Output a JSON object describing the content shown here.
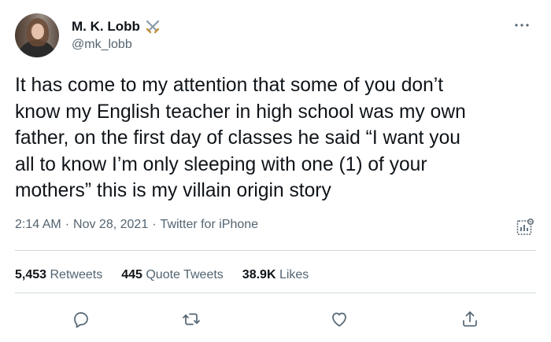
{
  "author": {
    "name": "M. K. Lobb",
    "handle": "@mk_lobb",
    "name_emoji_icon": "crossed-swords-icon"
  },
  "tweet": {
    "lines": [
      "It has come to my attention that some of you don’t",
      "know my English teacher in high school was my own",
      "father, on the first day of classes he said “I want you",
      "all to know I’m only sleeping with one (1) of your",
      "mothers” this is my villain origin story"
    ]
  },
  "meta": {
    "time": "2:14 AM",
    "date": "Nov 28, 2021",
    "separator": "·",
    "source": "Twitter for iPhone"
  },
  "stats": {
    "retweets_count": "5,453",
    "retweets_label": "Retweets",
    "quotes_count": "445",
    "quotes_label": "Quote Tweets",
    "likes_count": "38.9K",
    "likes_label": "Likes"
  },
  "icons": {
    "more": "more-horizontal-icon",
    "analytics": "analytics-icon",
    "reply": "reply-icon",
    "retweet": "retweet-icon",
    "like": "heart-icon",
    "share": "share-icon"
  },
  "colors": {
    "text": "#0f1419",
    "secondary": "#536471",
    "divider": "#cfd9de"
  }
}
